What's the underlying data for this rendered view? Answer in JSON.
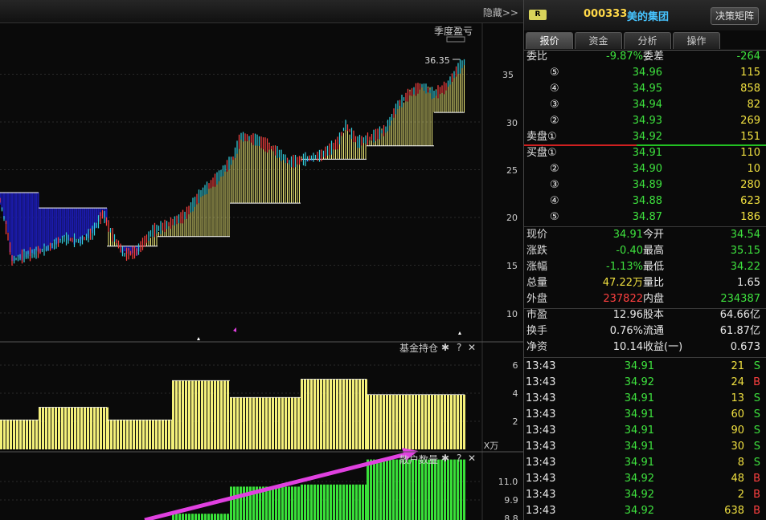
{
  "toolbar": {
    "hide_label": "隐藏>>"
  },
  "main_chart": {
    "indicator_label": "季度盈亏",
    "peak_label": "36.35",
    "y_ticks": [
      "35",
      "30",
      "25",
      "20",
      "15",
      "10"
    ]
  },
  "fund_panel": {
    "title": "基金持仓",
    "y_ticks": [
      "6",
      "4",
      "2"
    ],
    "unit": "X万"
  },
  "holder_panel": {
    "title": "散户数量",
    "y_ticks": [
      "11.0",
      "9.9",
      "8.8"
    ]
  },
  "header": {
    "badge": "R",
    "code": "000333",
    "name": "美的集团",
    "decision_button": "决策矩阵"
  },
  "tabs": [
    "报价",
    "资金",
    "分析",
    "操作"
  ],
  "quote": {
    "wei_bi_label": "委比",
    "wei_bi": "-9.87%",
    "wei_cha_label": "委差",
    "wei_cha": "-264",
    "sell": [
      {
        "label": "⑤",
        "price": "34.96",
        "vol": "115"
      },
      {
        "label": "④",
        "price": "34.95",
        "vol": "858"
      },
      {
        "label": "③",
        "price": "34.94",
        "vol": "82"
      },
      {
        "label": "②",
        "price": "34.93",
        "vol": "269"
      },
      {
        "label": "卖盘①",
        "price": "34.92",
        "vol": "151"
      }
    ],
    "buy": [
      {
        "label": "买盘①",
        "price": "34.91",
        "vol": "110"
      },
      {
        "label": "②",
        "price": "34.90",
        "vol": "10"
      },
      {
        "label": "③",
        "price": "34.89",
        "vol": "280"
      },
      {
        "label": "④",
        "price": "34.88",
        "vol": "623"
      },
      {
        "label": "⑤",
        "price": "34.87",
        "vol": "186"
      }
    ],
    "stats": [
      {
        "l1": "现价",
        "v1": "34.91",
        "c1": "green",
        "l2": "今开",
        "v2": "34.54",
        "c2": "green"
      },
      {
        "l1": "涨跌",
        "v1": "-0.40",
        "c1": "green",
        "l2": "最高",
        "v2": "35.15",
        "c2": "green"
      },
      {
        "l1": "涨幅",
        "v1": "-1.13%",
        "c1": "green",
        "l2": "最低",
        "v2": "34.22",
        "c2": "green"
      },
      {
        "l1": "总量",
        "v1": "47.22万",
        "c1": "yellow",
        "l2": "量比",
        "v2": "1.65",
        "c2": "white"
      },
      {
        "l1": "外盘",
        "v1": "237822",
        "c1": "red",
        "l2": "内盘",
        "v2": "234387",
        "c2": "green"
      },
      {
        "l1": "市盈",
        "v1": "12.96",
        "c1": "white",
        "l2": "股本",
        "v2": "64.66亿",
        "c2": "white"
      },
      {
        "l1": "换手",
        "v1": "0.76%",
        "c1": "white",
        "l2": "流通",
        "v2": "61.87亿",
        "c2": "white"
      },
      {
        "l1": "净资",
        "v1": "10.14",
        "c1": "white",
        "l2": "收益(一)",
        "v2": "0.673",
        "c2": "white"
      }
    ]
  },
  "ticks": [
    {
      "time": "13:43",
      "price": "34.91",
      "vol": "21",
      "side": "S"
    },
    {
      "time": "13:43",
      "price": "34.92",
      "vol": "24",
      "side": "B"
    },
    {
      "time": "13:43",
      "price": "34.91",
      "vol": "13",
      "side": "S"
    },
    {
      "time": "13:43",
      "price": "34.91",
      "vol": "60",
      "side": "S"
    },
    {
      "time": "13:43",
      "price": "34.91",
      "vol": "90",
      "side": "S"
    },
    {
      "time": "13:43",
      "price": "34.91",
      "vol": "30",
      "side": "S"
    },
    {
      "time": "13:43",
      "price": "34.91",
      "vol": "8",
      "side": "S"
    },
    {
      "time": "13:43",
      "price": "34.92",
      "vol": "48",
      "side": "B"
    },
    {
      "time": "13:43",
      "price": "34.92",
      "vol": "2",
      "side": "B"
    },
    {
      "time": "13:43",
      "price": "34.92",
      "vol": "638",
      "side": "B"
    }
  ],
  "colors": {
    "up": "#ff4040",
    "down": "#3ee23e",
    "fund_bar": "#f4f07a",
    "holder_bar": "#39e039",
    "loss_fill": "#1a1aa8",
    "arrow": "#e040e0"
  }
}
